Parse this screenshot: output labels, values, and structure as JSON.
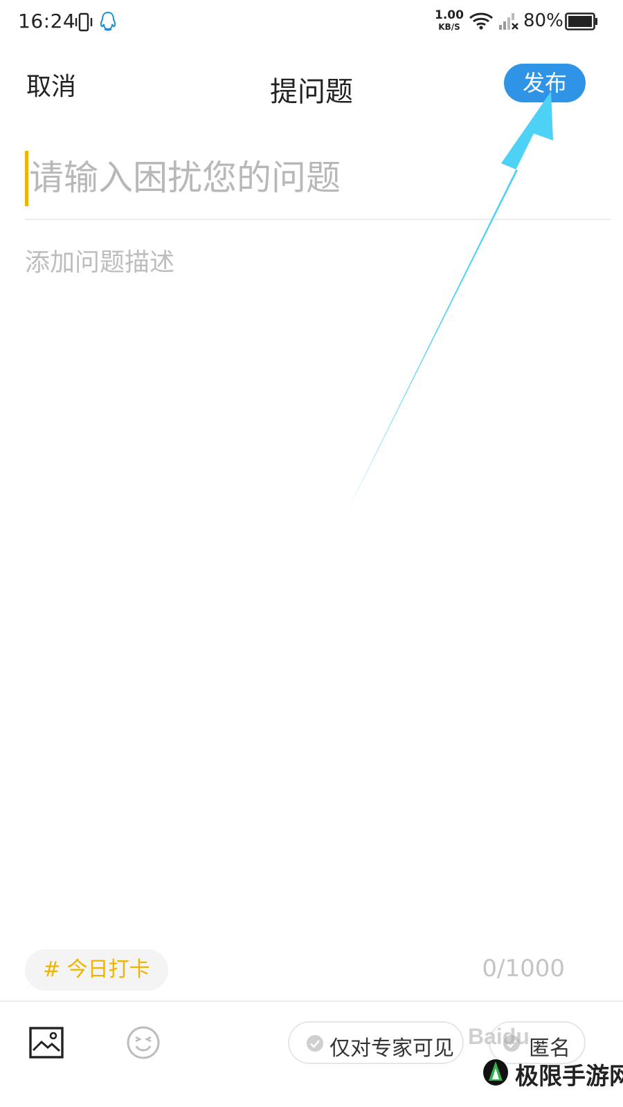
{
  "status_bar": {
    "time": "16:24",
    "net_speed_value": "1.00",
    "net_speed_unit": "KB/S",
    "battery_percent": "80%"
  },
  "header": {
    "cancel_label": "取消",
    "title": "提问题",
    "publish_label": "发布",
    "publish_color": "#2f94e6"
  },
  "question": {
    "title_placeholder": "请输入困扰您的问题",
    "description_placeholder": "添加问题描述",
    "caret_color": "#f0b400"
  },
  "tag": {
    "label": "# 今日打卡",
    "color": "#f0b400"
  },
  "counter": {
    "text": "0/1000",
    "current": 0,
    "max": 1000
  },
  "toolbar": {
    "image_icon": "image-icon",
    "emoji_icon": "emoji-icon",
    "expert_only_label": "仅对专家可见",
    "anonymous_label": "匿名"
  },
  "annotation": {
    "arrow_color": "#4dd2f5"
  },
  "watermark": {
    "baidu_text": "Baidu",
    "site_text": "极限手游网"
  }
}
